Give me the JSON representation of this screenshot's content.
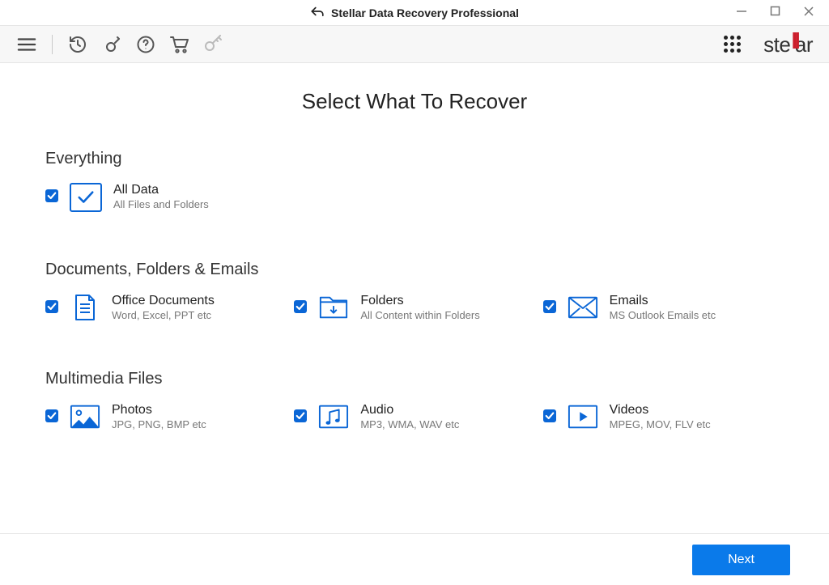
{
  "app_title": "Stellar Data Recovery Professional",
  "page_title": "Select What To Recover",
  "logo_text": "stellar",
  "sections": {
    "everything": {
      "title": "Everything",
      "all_data": {
        "title": "All Data",
        "desc": "All Files and Folders"
      }
    },
    "docs": {
      "title": "Documents, Folders & Emails",
      "office": {
        "title": "Office Documents",
        "desc": "Word, Excel, PPT etc"
      },
      "folders": {
        "title": "Folders",
        "desc": "All Content within Folders"
      },
      "emails": {
        "title": "Emails",
        "desc": "MS Outlook Emails etc"
      }
    },
    "media": {
      "title": "Multimedia Files",
      "photos": {
        "title": "Photos",
        "desc": "JPG, PNG, BMP etc"
      },
      "audio": {
        "title": "Audio",
        "desc": "MP3, WMA, WAV etc"
      },
      "videos": {
        "title": "Videos",
        "desc": "MPEG, MOV, FLV etc"
      }
    }
  },
  "footer": {
    "next_label": "Next"
  }
}
